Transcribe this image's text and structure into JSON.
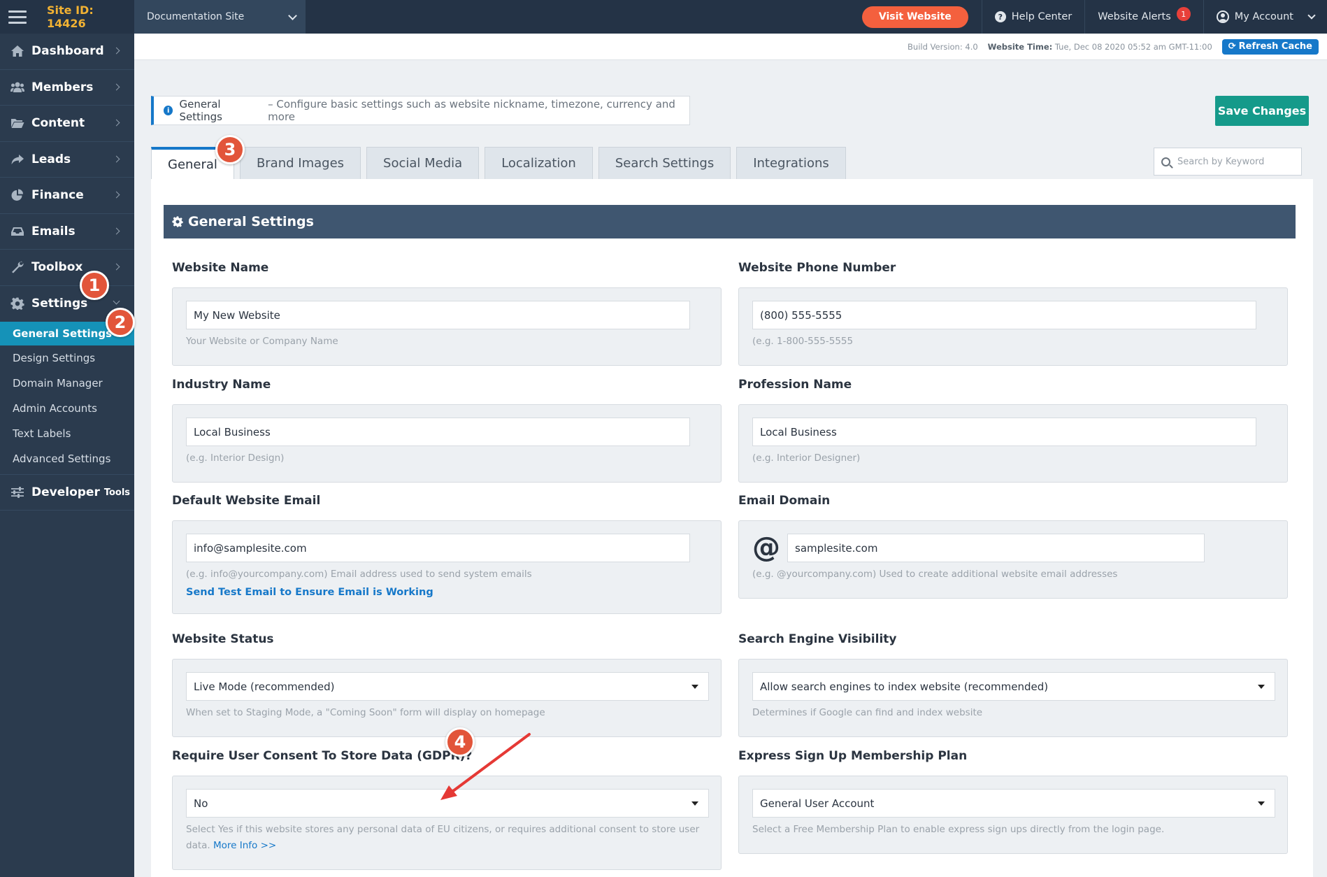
{
  "topbar": {
    "site_id": "Site ID: 14426",
    "site_select": "Documentation Site",
    "visit_website": "Visit Website",
    "help_center": "Help Center",
    "website_alerts": "Website Alerts",
    "alerts_count": "1",
    "my_account": "My Account"
  },
  "subheader": {
    "build_version": "Build Version: 4.0",
    "website_time_label": "Website Time:",
    "website_time_value": "Tue, Dec 08 2020 05:52 am GMT-11:00",
    "refresh_cache": "Refresh Cache"
  },
  "sidebar": {
    "items": [
      {
        "label": "Dashboard",
        "icon": "home-icon"
      },
      {
        "label": "Members",
        "icon": "users-icon"
      },
      {
        "label": "Content",
        "icon": "folder-icon"
      },
      {
        "label": "Leads",
        "icon": "share-icon"
      },
      {
        "label": "Finance",
        "icon": "pie-chart-icon"
      },
      {
        "label": "Emails",
        "icon": "inbox-icon"
      },
      {
        "label": "Toolbox",
        "icon": "wrench-icon"
      },
      {
        "label": "Settings",
        "icon": "gear-icon"
      }
    ],
    "submenu": [
      "General Settings",
      "Design Settings",
      "Domain Manager",
      "Admin Accounts",
      "Text Labels",
      "Advanced Settings"
    ],
    "developer": "Developer",
    "developer_small": "Tools"
  },
  "info_bar": {
    "title": "General Settings",
    "description": "– Configure basic settings such as website nickname, timezone, currency and more"
  },
  "save_changes": "Save Changes",
  "tabs": [
    "General",
    "Brand Images",
    "Social Media",
    "Localization",
    "Search Settings",
    "Integrations"
  ],
  "search": {
    "placeholder": "Search by Keyword"
  },
  "panel_title": "General Settings",
  "fields": {
    "website_name": {
      "label": "Website Name",
      "value": "My New Website",
      "help": "Your Website or Company Name"
    },
    "website_phone": {
      "label": "Website Phone Number",
      "value": "(800) 555-5555",
      "help": "(e.g. 1-800-555-5555"
    },
    "industry_name": {
      "label": "Industry Name",
      "value": "Local Business",
      "help": "(e.g. Interior Design)"
    },
    "profession_name": {
      "label": "Profession Name",
      "value": "Local Business",
      "help": "(e.g. Interior Designer)"
    },
    "default_email": {
      "label": "Default Website Email",
      "value": "info@samplesite.com",
      "help": "(e.g. info@yourcompany.com) Email address used to send system emails",
      "link": "Send Test Email to Ensure Email is Working"
    },
    "email_domain": {
      "label": "Email Domain",
      "prefix": "@",
      "value": "samplesite.com",
      "help": "(e.g. @yourcompany.com) Used to create additional website email addresses"
    },
    "website_status": {
      "label": "Website Status",
      "value": "Live Mode (recommended)",
      "help": "When set to Staging Mode, a \"Coming Soon\" form will display on homepage"
    },
    "search_visibility": {
      "label": "Search Engine Visibility",
      "value": "Allow search engines to index website (recommended)",
      "help": "Determines if Google can find and index website"
    },
    "gdpr": {
      "label": "Require User Consent To Store Data (GDPR)?",
      "value": "No",
      "help": "Select Yes if this website stores any personal data of EU citizens, or requires additional consent to store user data.",
      "link": "More Info >>"
    },
    "express_signup": {
      "label": "Express Sign Up Membership Plan",
      "value": "General User Account",
      "help": "Select a Free Membership Plan to enable express sign ups directly from the login page."
    }
  },
  "annotations": [
    "1",
    "2",
    "3",
    "4"
  ],
  "colors": {
    "topbar": "#243346",
    "sidebar": "#2b3b4e",
    "accent_blue": "#1678c9",
    "active_sub": "#1592b8",
    "visit_button": "#f4603e",
    "save_button": "#159a8a",
    "panel_header": "#3f5670",
    "annotation": "#e2553a",
    "site_id": "#f2b233"
  }
}
